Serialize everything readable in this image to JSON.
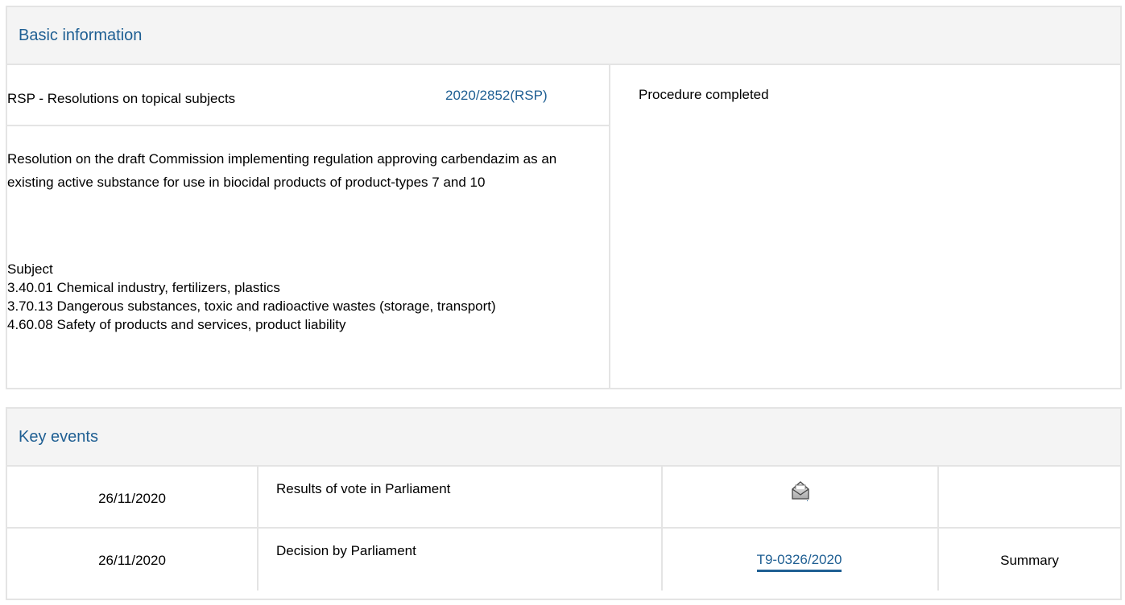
{
  "basic_information": {
    "header": "Basic information",
    "procedure_type": "RSP - Resolutions on topical subjects",
    "procedure_reference": "2020/2852(RSP)",
    "title": "Resolution on the draft Commission implementing regulation approving carbendazim as an existing active substance for use in biocidal products of product-types 7 and 10",
    "subject_label": "Subject",
    "subjects": [
      "3.40.01 Chemical industry, fertilizers, plastics",
      "3.70.13 Dangerous substances, toxic and radioactive wastes (storage, transport)",
      "4.60.08 Safety of products and services, product liability"
    ],
    "status": "Procedure completed"
  },
  "key_events": {
    "header": "Key events",
    "rows": [
      {
        "date": "26/11/2020",
        "event": "Results of vote in Parliament",
        "document": "",
        "document_icon": "envelope-icon",
        "summary": ""
      },
      {
        "date": "26/11/2020",
        "event": "Decision by Parliament",
        "document": "T9-0326/2020",
        "summary": "Summary"
      }
    ]
  },
  "colors": {
    "link": "#1f5f93",
    "header_bg": "#f4f4f4",
    "border": "#e4e4e4"
  }
}
